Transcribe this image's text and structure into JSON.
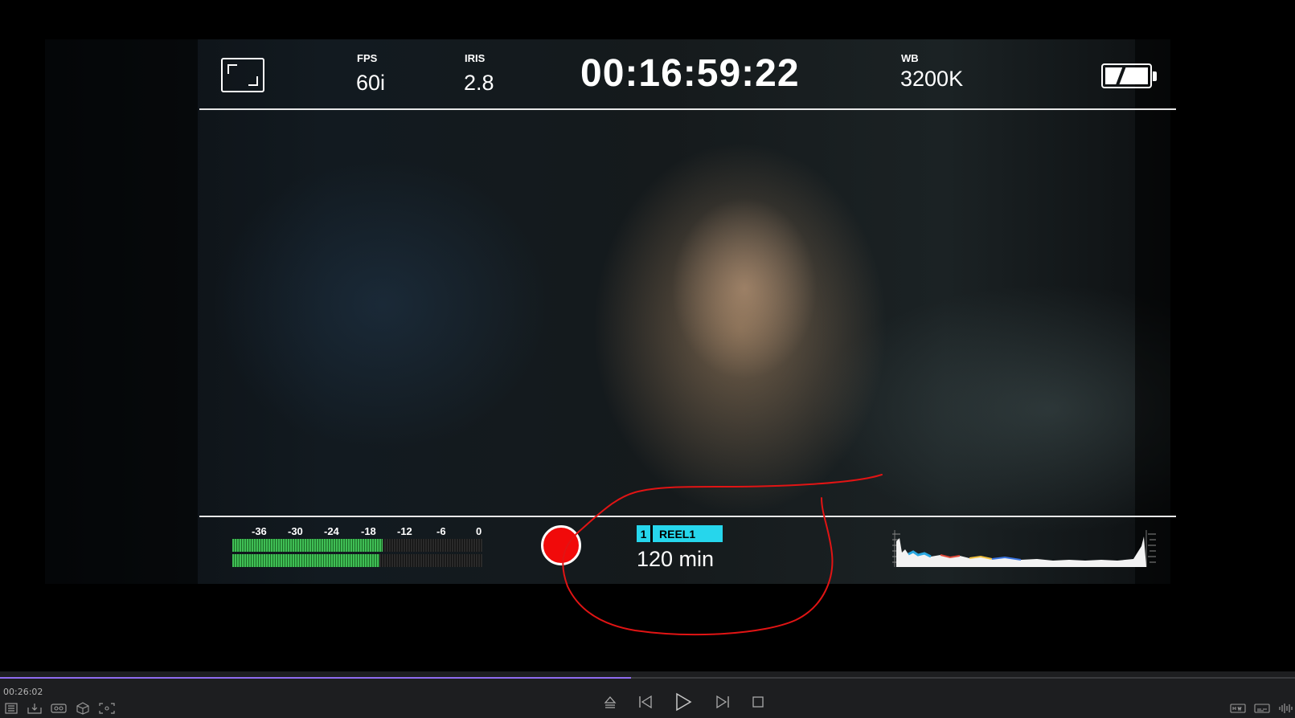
{
  "hud": {
    "fps_label": "FPS",
    "fps_value": "60i",
    "iris_label": "IRIS",
    "iris_value": "2.8",
    "timecode": "00:16:59:22",
    "wb_label": "WB",
    "wb_value": "3200K",
    "battery_level": 0.85
  },
  "audio": {
    "ticks": [
      "-36",
      "-30",
      "-24",
      "-18",
      "-12",
      "-6",
      "0"
    ],
    "channels": [
      {
        "name": "ch1",
        "level": 0.6
      },
      {
        "name": "ch2",
        "level": 0.59
      }
    ]
  },
  "record": {
    "reel_number": "1",
    "reel_name": "REEL1",
    "remaining": "120 min"
  },
  "playback": {
    "current_time": "00:26:02",
    "progress": 0.487
  },
  "colors": {
    "record": "#f10a0a",
    "reel_badge": "#26d6ec",
    "meter_green": "#3fbe55",
    "scrubber": "#8f6cf0",
    "annotation": "#e11414"
  }
}
